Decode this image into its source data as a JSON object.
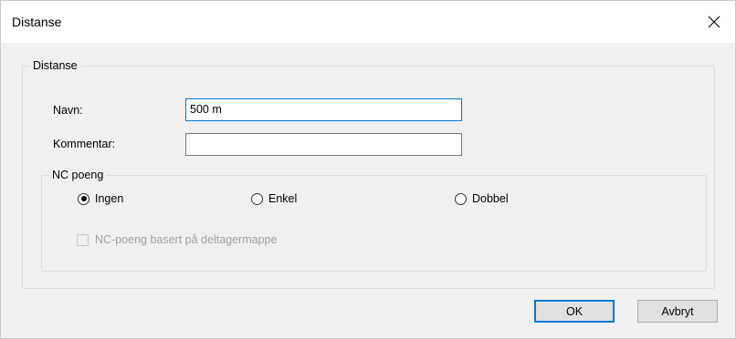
{
  "window": {
    "title": "Distanse"
  },
  "group_main": {
    "legend": "Distanse"
  },
  "fields": {
    "name_label": "Navn:",
    "name_value": "500 m",
    "comment_label": "Kommentar:",
    "comment_value": ""
  },
  "nc_group": {
    "legend": "NC poeng",
    "options": [
      {
        "label": "Ingen",
        "checked": true
      },
      {
        "label": "Enkel",
        "checked": false
      },
      {
        "label": "Dobbel",
        "checked": false
      }
    ],
    "checkbox_label": "NC-poeng basert på deltagermappe",
    "checkbox_enabled": false,
    "checkbox_checked": false
  },
  "buttons": {
    "ok": "OK",
    "cancel": "Avbryt"
  },
  "icons": {
    "close": "close-icon"
  },
  "colors": {
    "focus_accent": "#0078d7",
    "dialog_bg": "#f0f0f0"
  }
}
